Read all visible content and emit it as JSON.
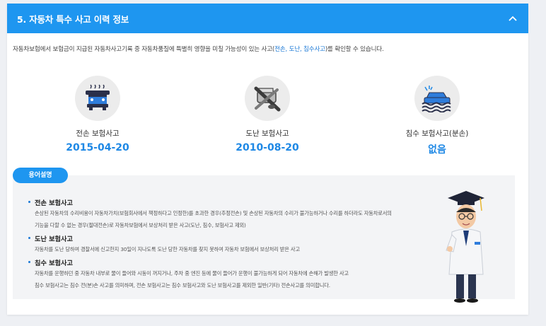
{
  "header": {
    "title": "5. 자동차 특수 사고 이력 정보"
  },
  "intro": {
    "prefix": "자동차보험에서 보험금이 지급된 자동차사고기록 중 자동차품질에 특별히 영향을 미칠 가능성이 있는 사고(",
    "highlight": "전손, 도난, 침수사고",
    "suffix": ")를 확인할 수 있습니다."
  },
  "stats": [
    {
      "label": "전손 보험사고",
      "value": "2015-04-20",
      "icon": "crashed-car-icon"
    },
    {
      "label": "도난 보험사고",
      "value": "2010-08-20",
      "icon": "stolen-car-icon"
    },
    {
      "label": "침수 보험사고(분손)",
      "value": "없음",
      "icon": "flooded-car-icon"
    }
  ],
  "glossary": {
    "badge": "용어설명",
    "terms": [
      {
        "title": "전손 보험사고",
        "lines": [
          "손상된 자동차의 수리비용이 자동차가치(보험회사에서 책정하다고 인정한)를 초과한 경우(추정전손) 및 손상된 자동차의 수리가 불가능하거나 수리를 하더라도 자동차로서의",
          "기능을 다할 수 없는 경우(절대전손)로 자동차보험에서 보상처리 받은 사고(도난, 침수, 보험사고 제외)"
        ]
      },
      {
        "title": "도난 보험사고",
        "lines": [
          "자동차를 도난 당하여 경찰서에 신고한지 30일이 지나도록 도난 당한 자동차를 찾지 못하여 자동차 보험에서 보상처리 받은 사고"
        ]
      },
      {
        "title": "침수 보험사고",
        "lines": [
          "자동차를 운행하던 중 자동차 내부로 물이 들어와 시동이 꺼지거나, 주차 중 엔진 등에 물이 들어가 운행이 불가능하게 되어 자동차에 손해가 발생한 사고",
          "침수 보험사고는 침수 전(분)손 사고를 의미하며, 전손 보험사고는 침수 보험사고와 도난 보험사고를 제외한 일반(기타) 전손사고를 의미합니다."
        ]
      }
    ]
  },
  "colors": {
    "accent": "#1e96f0",
    "value": "#1e88e5",
    "panel": "#f3f4f6"
  }
}
